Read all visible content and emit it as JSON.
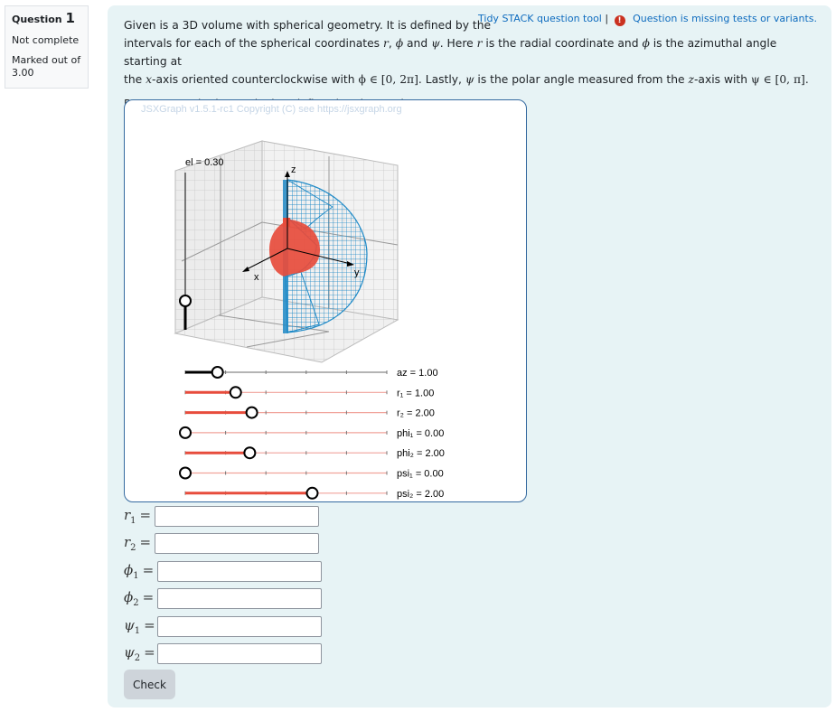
{
  "info": {
    "question_label": "Question",
    "question_number": "1",
    "state": "Not complete",
    "marked_out_of": "Marked out of 3.00"
  },
  "toplinks": {
    "tidy_tool": "Tidy STACK question tool",
    "separator": "|",
    "warning_icon": "exclamation-circle-icon",
    "missing_tests": "Question is missing tests or variants."
  },
  "question": {
    "line1": "Given is a 3D volume with spherical geometry. It is defined by the",
    "line2_a": "intervals for each of the spherical coordinates ",
    "line2_r": "r",
    "line2_b": ", ",
    "line2_phi": "ϕ",
    "line2_c": " and ",
    "line2_psi": "ψ",
    "line2_d": ". Here ",
    "line2_r2": "r",
    "line2_e": " is the radial coordinate and ",
    "line2_phi2": "ϕ",
    "line2_f": " is the azimuthal angle starting at",
    "line3_a": "the ",
    "line3_x": "x",
    "line3_b": "-axis oriented counterclockwise with ",
    "line3_phi_range": "ϕ ∈ [0, 2π]",
    "line3_c": ". Lastly, ",
    "line3_psi": "ψ",
    "line3_d": " is the polar angle measured from the ",
    "line3_z": "z",
    "line3_e": "-axis with ",
    "line3_psi_range": "ψ ∈ [0, π]",
    "line3_f": ".",
    "instruction": "Reconstruct the intervals that define the given volume."
  },
  "board": {
    "copyright": "JSXGraph v1.5.1-rc1 Copyright (C) see https://jsxgraph.org",
    "axis_labels": {
      "x": "x",
      "y": "y",
      "z": "z"
    },
    "elevation": {
      "label": "el = 0.30",
      "value": 0.3,
      "fraction": 0.05
    },
    "sliders": [
      {
        "name": "az",
        "label": "az = 1.00",
        "value": 1.0,
        "fraction": 0.16,
        "color": "#000000"
      },
      {
        "name": "r1",
        "label": "r₁ = 1.00",
        "value": 1.0,
        "fraction": 0.25,
        "color": "#e74c3c"
      },
      {
        "name": "r2",
        "label": "r₂ = 2.00",
        "value": 2.0,
        "fraction": 0.33,
        "color": "#e74c3c"
      },
      {
        "name": "phi1",
        "label": "phi₁ = 0.00",
        "value": 0.0,
        "fraction": 0.0,
        "color": "#e74c3c"
      },
      {
        "name": "phi2",
        "label": "phi₂ = 2.00",
        "value": 2.0,
        "fraction": 0.32,
        "color": "#e74c3c"
      },
      {
        "name": "psi1",
        "label": "psi₁ = 0.00",
        "value": 0.0,
        "fraction": 0.0,
        "color": "#e74c3c"
      },
      {
        "name": "psi2",
        "label": "psi₂ = 2.00",
        "value": 2.0,
        "fraction": 0.63,
        "color": "#e74c3c"
      }
    ],
    "inner_color": "#e74c3c",
    "outer_color": "#1f8ac7"
  },
  "fields": [
    {
      "sym": "r",
      "sub": "1",
      "value": ""
    },
    {
      "sym": "r",
      "sub": "2",
      "value": ""
    },
    {
      "sym": "ϕ",
      "sub": "1",
      "value": ""
    },
    {
      "sym": "ϕ",
      "sub": "2",
      "value": ""
    },
    {
      "sym": "ψ",
      "sub": "1",
      "value": ""
    },
    {
      "sym": "ψ",
      "sub": "2",
      "value": ""
    }
  ],
  "eq_sign": "=",
  "check_label": "Check"
}
